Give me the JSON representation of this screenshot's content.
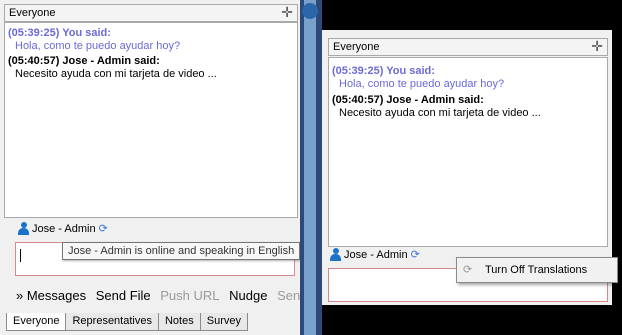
{
  "left_panel": {
    "header_title": "Everyone",
    "messages": [
      {
        "header": "(05:39:25) You said:",
        "text": "Hola, como te puedo ayudar hoy?"
      },
      {
        "header": "(05:40:57) Jose - Admin said:",
        "text": "Necesito ayuda con mi tarjeta de video ..."
      }
    ],
    "user_name": "Jose - Admin",
    "tooltip": "Jose - Admin is online and speaking in English",
    "toolbar": {
      "messages": "» Messages",
      "send_file": "Send File",
      "push_url": "Push URL",
      "nudge": "Nudge",
      "send": "Send"
    },
    "tabs": [
      "Everyone",
      "Representatives",
      "Notes",
      "Survey"
    ]
  },
  "right_panel": {
    "header_title": "Everyone",
    "messages": [
      {
        "header": "(05:39:25) You said:",
        "text": "Hola, como te puedo ayudar hoy?"
      },
      {
        "header": "(05:40:57) Jose - Admin said:",
        "text": "Necesito ayuda con mi tarjeta de video ..."
      }
    ],
    "user_name": "Jose - Admin",
    "context_menu": {
      "item": "Turn Off Translations"
    }
  },
  "colors": {
    "you_said": "#6a6ad8",
    "person_icon": "#1a73c9",
    "input_border": "#d48a8a"
  }
}
